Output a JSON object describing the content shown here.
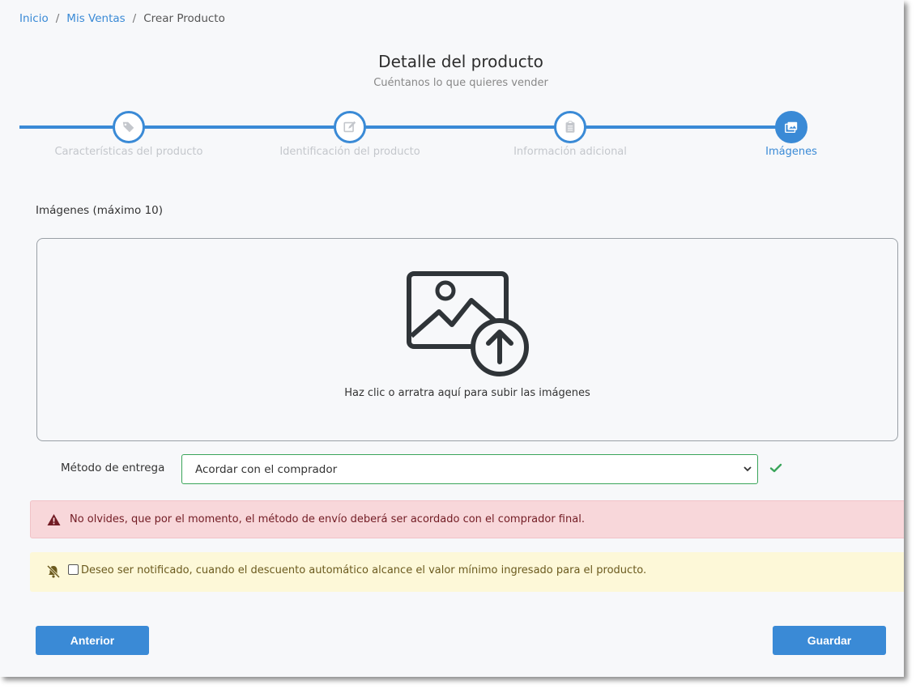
{
  "breadcrumb": {
    "items": [
      {
        "label": "Inicio"
      },
      {
        "label": "Mis Ventas"
      },
      {
        "label": "Crear Producto"
      }
    ],
    "separator": "/"
  },
  "header": {
    "title": "Detalle del producto",
    "subtitle": "Cuéntanos lo que quieres vender"
  },
  "stepper": {
    "steps": [
      {
        "label": "Características del producto",
        "icon": "tags-icon"
      },
      {
        "label": "Identificación del producto",
        "icon": "edit-icon"
      },
      {
        "label": "Información adicional",
        "icon": "clipboard-icon"
      },
      {
        "label": "Imágenes",
        "icon": "images-icon",
        "active": true
      }
    ]
  },
  "images": {
    "label": "Imágenes (máximo 10)",
    "dropzone_hint": "Haz clic o arratra aquí para subir las imágenes"
  },
  "delivery": {
    "label": "Método de entrega",
    "selected": "Acordar con el comprador"
  },
  "alerts": {
    "danger": "No olvides, que por el momento, el método de envío deberá ser acordado con el comprador final.",
    "warning": "Deseo ser notificado, cuando el descuento automático alcance el valor mínimo ingresado para el producto."
  },
  "buttons": {
    "previous": "Anterior",
    "save": "Guardar"
  },
  "colors": {
    "primary": "#3a8ad6",
    "success": "#3aa55a",
    "danger_bg": "#f8d7da",
    "danger_text": "#721c24",
    "warning_bg": "#fdf8d8"
  }
}
